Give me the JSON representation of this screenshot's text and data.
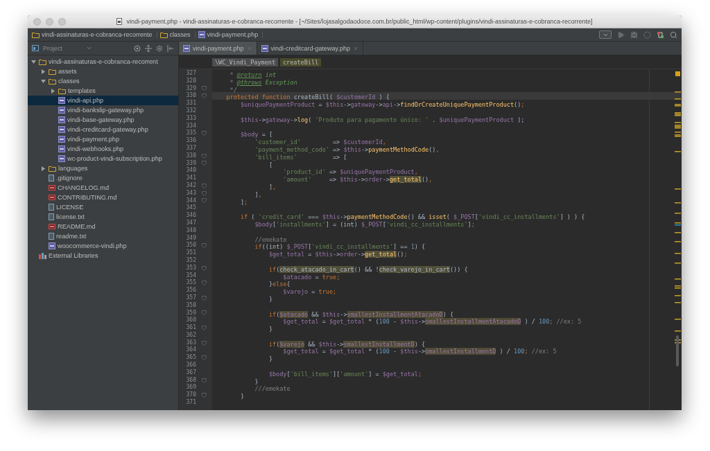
{
  "window": {
    "title": "vindi-payment.php - vindi-assinaturas-e-cobranca-recorrente - [~/Sites/lojasalgodaodoce.com.br/public_html/wp-content/plugins/vindi-assinaturas-e-cobranca-recorrente]"
  },
  "navbar": {
    "crumbs": [
      {
        "label": "vindi-assinaturas-e-cobranca-recorrente",
        "kind": "folder"
      },
      {
        "label": "classes",
        "kind": "folder"
      },
      {
        "label": "vindi-payment.php",
        "kind": "php"
      }
    ]
  },
  "project_panel": {
    "title": "Project",
    "tree": [
      {
        "name": "vindi-assinaturas-e-cobranca-recorrent",
        "kind": "folder",
        "expanded": true,
        "selected": false,
        "children": [
          {
            "name": "assets",
            "kind": "folder",
            "expanded": false,
            "selected": false
          },
          {
            "name": "classes",
            "kind": "folder",
            "expanded": true,
            "selected": false,
            "children": [
              {
                "name": "templates",
                "kind": "folder",
                "expanded": false,
                "selected": false
              },
              {
                "name": "vindi-api.php",
                "kind": "php",
                "selected": true
              },
              {
                "name": "vindi-bankslip-gateway.php",
                "kind": "php",
                "selected": false
              },
              {
                "name": "vindi-base-gateway.php",
                "kind": "php",
                "selected": false
              },
              {
                "name": "vindi-creditcard-gateway.php",
                "kind": "php",
                "selected": false
              },
              {
                "name": "vindi-payment.php",
                "kind": "php",
                "selected": false
              },
              {
                "name": "vindi-webhooks.php",
                "kind": "php",
                "selected": false
              },
              {
                "name": "wc-product-vindi-subscription.php",
                "kind": "php",
                "selected": false
              }
            ]
          },
          {
            "name": "languages",
            "kind": "folder",
            "expanded": false,
            "selected": false
          },
          {
            "name": ".gitignore",
            "kind": "text",
            "selected": false
          },
          {
            "name": "CHANGELOG.md",
            "kind": "md",
            "selected": false
          },
          {
            "name": "CONTRIBUTING.md",
            "kind": "md",
            "selected": false
          },
          {
            "name": "LICENSE",
            "kind": "text",
            "selected": false
          },
          {
            "name": "license.txt",
            "kind": "text",
            "selected": false
          },
          {
            "name": "README.md",
            "kind": "md",
            "selected": false
          },
          {
            "name": "readme.txt",
            "kind": "text",
            "selected": false
          },
          {
            "name": "woocommerce-vindi.php",
            "kind": "php",
            "selected": false
          }
        ]
      },
      {
        "name": "External Libraries",
        "kind": "library",
        "selected": false
      }
    ]
  },
  "tabs": [
    {
      "label": "vindi-payment.php",
      "selected": true
    },
    {
      "label": "vindi-creditcard-gateway.php",
      "selected": false
    }
  ],
  "editor": {
    "breadcrumbs": [
      {
        "label": "\\WC_Vindi_Payment",
        "kind": "class"
      },
      {
        "label": "createBill",
        "kind": "method"
      }
    ],
    "lines": [
      {
        "num": "327",
        "fold": false,
        "current": false,
        "tokens": [
          {
            "kind": "c",
            "text": "     * "
          },
          {
            "kind": "dt",
            "text": "@return"
          },
          {
            "kind": "di",
            "text": " int"
          }
        ]
      },
      {
        "num": "328",
        "fold": false,
        "current": false,
        "tokens": [
          {
            "kind": "c",
            "text": "     * "
          },
          {
            "kind": "dt",
            "text": "@throws"
          },
          {
            "kind": "di",
            "text": " Exception"
          }
        ]
      },
      {
        "num": "329",
        "fold": true,
        "current": false,
        "tokens": [
          {
            "kind": "c",
            "text": "     */"
          }
        ]
      },
      {
        "num": "330",
        "fold": true,
        "current": true,
        "tokens": [
          {
            "kind": "k",
            "text": "    protected function "
          },
          {
            "kind": "p",
            "text": "createBill( "
          },
          {
            "kind": "v",
            "text": "$customerId"
          },
          {
            "kind": "p",
            "text": " ) {"
          }
        ]
      },
      {
        "num": "331",
        "fold": false,
        "current": false,
        "tokens": [
          {
            "kind": "v",
            "text": "        $uniquePaymentProduct"
          },
          {
            "kind": "p",
            "text": " = "
          },
          {
            "kind": "v",
            "text": "$this"
          },
          {
            "kind": "p",
            "text": "->"
          },
          {
            "kind": "v",
            "text": "gateway"
          },
          {
            "kind": "p",
            "text": "->"
          },
          {
            "kind": "v",
            "text": "api"
          },
          {
            "kind": "p",
            "text": "->"
          },
          {
            "kind": "f",
            "text": "findOrCreateUniquePaymentProduct"
          },
          {
            "kind": "p",
            "text": "()"
          },
          {
            "kind": "k",
            "text": ";"
          }
        ]
      },
      {
        "num": "332",
        "fold": false,
        "current": false
      },
      {
        "num": "333",
        "fold": false,
        "current": false,
        "tokens": [
          {
            "kind": "v",
            "text": "        $this"
          },
          {
            "kind": "p",
            "text": "->"
          },
          {
            "kind": "v",
            "text": "gateway"
          },
          {
            "kind": "p",
            "text": "->"
          },
          {
            "kind": "f",
            "text": "log"
          },
          {
            "kind": "p",
            "text": "( "
          },
          {
            "kind": "s",
            "text": "'Produto para pagamento único: '"
          },
          {
            "kind": "p",
            "text": " . "
          },
          {
            "kind": "v",
            "text": "$uniquePaymentProduct"
          },
          {
            "kind": "p",
            "text": " );"
          }
        ]
      },
      {
        "num": "334",
        "fold": false,
        "current": false
      },
      {
        "num": "335",
        "fold": true,
        "current": false,
        "tokens": [
          {
            "kind": "v",
            "text": "        $body"
          },
          {
            "kind": "p",
            "text": " = ["
          }
        ]
      },
      {
        "num": "336",
        "fold": false,
        "current": false,
        "tokens": [
          {
            "kind": "s",
            "text": "            'customer_id'"
          },
          {
            "kind": "p",
            "text": "         => "
          },
          {
            "kind": "v",
            "text": "$customerId"
          },
          {
            "kind": "k",
            "text": ","
          }
        ]
      },
      {
        "num": "337",
        "fold": false,
        "current": false,
        "tokens": [
          {
            "kind": "s",
            "text": "            'payment_method_code'"
          },
          {
            "kind": "p",
            "text": " => "
          },
          {
            "kind": "v",
            "text": "$this"
          },
          {
            "kind": "p",
            "text": "->"
          },
          {
            "kind": "f",
            "text": "paymentMethodCode"
          },
          {
            "kind": "p",
            "text": "()"
          },
          {
            "kind": "k",
            "text": ","
          }
        ]
      },
      {
        "num": "338",
        "fold": true,
        "current": false,
        "tokens": [
          {
            "kind": "s",
            "text": "            'bill_items'"
          },
          {
            "kind": "p",
            "text": "          => ["
          }
        ]
      },
      {
        "num": "339",
        "fold": true,
        "current": false,
        "tokens": [
          {
            "kind": "p",
            "text": "                ["
          }
        ]
      },
      {
        "num": "340",
        "fold": false,
        "current": false,
        "tokens": [
          {
            "kind": "s",
            "text": "                    'product_id'"
          },
          {
            "kind": "p",
            "text": " => "
          },
          {
            "kind": "v",
            "text": "$uniquePaymentProduct"
          },
          {
            "kind": "k",
            "text": ","
          }
        ]
      },
      {
        "num": "341",
        "fold": false,
        "current": false,
        "tokens": [
          {
            "kind": "s",
            "text": "                    'amount'"
          },
          {
            "kind": "p",
            "text": "     => "
          },
          {
            "kind": "v",
            "text": "$this"
          },
          {
            "kind": "p",
            "text": "->"
          },
          {
            "kind": "v",
            "text": "order"
          },
          {
            "kind": "p",
            "text": "->"
          },
          {
            "kind": "fh",
            "text": "get_total"
          },
          {
            "kind": "p",
            "text": "()"
          },
          {
            "kind": "k",
            "text": ","
          }
        ]
      },
      {
        "num": "342",
        "fold": true,
        "current": false,
        "tokens": [
          {
            "kind": "p",
            "text": "                ]"
          },
          {
            "kind": "k",
            "text": ","
          }
        ]
      },
      {
        "num": "343",
        "fold": true,
        "current": false,
        "tokens": [
          {
            "kind": "p",
            "text": "            ]"
          },
          {
            "kind": "k",
            "text": ","
          }
        ]
      },
      {
        "num": "344",
        "fold": true,
        "current": false,
        "tokens": [
          {
            "kind": "p",
            "text": "        ]"
          },
          {
            "kind": "k",
            "text": ";"
          }
        ]
      },
      {
        "num": "345",
        "fold": false,
        "current": false
      },
      {
        "num": "346",
        "fold": false,
        "current": false,
        "tokens": [
          {
            "kind": "k",
            "text": "        if"
          },
          {
            "kind": "p",
            "text": " ( "
          },
          {
            "kind": "s",
            "text": "'credit_card'"
          },
          {
            "kind": "p",
            "text": " === "
          },
          {
            "kind": "v",
            "text": "$this"
          },
          {
            "kind": "p",
            "text": "->"
          },
          {
            "kind": "f",
            "text": "paymentMethodCode"
          },
          {
            "kind": "p",
            "text": "() && "
          },
          {
            "kind": "f",
            "text": "isset"
          },
          {
            "kind": "p",
            "text": "( "
          },
          {
            "kind": "v",
            "text": "$_POST"
          },
          {
            "kind": "p",
            "text": "["
          },
          {
            "kind": "s",
            "text": "'vindi_cc_installments'"
          },
          {
            "kind": "p",
            "text": "] ) ) {"
          }
        ]
      },
      {
        "num": "347",
        "fold": false,
        "current": false,
        "tokens": [
          {
            "kind": "v",
            "text": "            $body"
          },
          {
            "kind": "p",
            "text": "["
          },
          {
            "kind": "s",
            "text": "'installments'"
          },
          {
            "kind": "p",
            "text": "] = (int) "
          },
          {
            "kind": "v",
            "text": "$_POST"
          },
          {
            "kind": "p",
            "text": "["
          },
          {
            "kind": "s",
            "text": "'vindi_cc_installments'"
          },
          {
            "kind": "p",
            "text": "]"
          },
          {
            "kind": "k",
            "text": ";"
          }
        ]
      },
      {
        "num": "348",
        "fold": false,
        "current": false
      },
      {
        "num": "349",
        "fold": false,
        "current": false,
        "tokens": [
          {
            "kind": "c",
            "text": "            //emekate"
          }
        ]
      },
      {
        "num": "350",
        "fold": true,
        "current": false,
        "tokens": [
          {
            "kind": "k",
            "text": "            if"
          },
          {
            "kind": "p",
            "text": "((int) "
          },
          {
            "kind": "v",
            "text": "$_POST"
          },
          {
            "kind": "p",
            "text": "["
          },
          {
            "kind": "s",
            "text": "'vindi_cc_installments'"
          },
          {
            "kind": "p",
            "text": "] == "
          },
          {
            "kind": "n",
            "text": "1"
          },
          {
            "kind": "p",
            "text": ") {"
          }
        ]
      },
      {
        "num": "351",
        "fold": false,
        "current": false,
        "tokens": [
          {
            "kind": "v",
            "text": "                $get_total"
          },
          {
            "kind": "p",
            "text": " = "
          },
          {
            "kind": "v",
            "text": "$this"
          },
          {
            "kind": "p",
            "text": "->"
          },
          {
            "kind": "v",
            "text": "order"
          },
          {
            "kind": "p",
            "text": "->"
          },
          {
            "kind": "fh",
            "text": "get_total"
          },
          {
            "kind": "p",
            "text": "()"
          },
          {
            "kind": "k",
            "text": ";"
          }
        ]
      },
      {
        "num": "352",
        "fold": false,
        "current": false
      },
      {
        "num": "353",
        "fold": true,
        "current": false,
        "tokens": [
          {
            "kind": "k",
            "text": "                if"
          },
          {
            "kind": "p",
            "text": "("
          },
          {
            "kind": "ph",
            "text": "check_atacado_in_cart"
          },
          {
            "kind": "p",
            "text": "() && !"
          },
          {
            "kind": "ph",
            "text": "check_varejo_in_cart"
          },
          {
            "kind": "p",
            "text": "()) {"
          }
        ]
      },
      {
        "num": "354",
        "fold": false,
        "current": false,
        "tokens": [
          {
            "kind": "v",
            "text": "                    $atacado"
          },
          {
            "kind": "p",
            "text": " = "
          },
          {
            "kind": "k",
            "text": "true;"
          }
        ]
      },
      {
        "num": "355",
        "fold": true,
        "current": false,
        "tokens": [
          {
            "kind": "p",
            "text": "                }"
          },
          {
            "kind": "k",
            "text": "else"
          },
          {
            "kind": "p",
            "text": "{"
          }
        ]
      },
      {
        "num": "356",
        "fold": false,
        "current": false,
        "tokens": [
          {
            "kind": "v",
            "text": "                    $varejo"
          },
          {
            "kind": "p",
            "text": " = "
          },
          {
            "kind": "k",
            "text": "true;"
          }
        ]
      },
      {
        "num": "357",
        "fold": true,
        "current": false,
        "tokens": [
          {
            "kind": "p",
            "text": "                }"
          }
        ]
      },
      {
        "num": "358",
        "fold": false,
        "current": false
      },
      {
        "num": "359",
        "fold": true,
        "current": false,
        "tokens": [
          {
            "kind": "k",
            "text": "                if"
          },
          {
            "kind": "p",
            "text": "("
          },
          {
            "kind": "vh",
            "text": "$atacado"
          },
          {
            "kind": "p",
            "text": " && "
          },
          {
            "kind": "v",
            "text": "$this"
          },
          {
            "kind": "p",
            "text": "->"
          },
          {
            "kind": "vh",
            "text": "smallestInstallmentAtacadoD"
          },
          {
            "kind": "p",
            "text": ") {"
          }
        ]
      },
      {
        "num": "360",
        "fold": false,
        "current": false,
        "tokens": [
          {
            "kind": "v",
            "text": "                    $get_total"
          },
          {
            "kind": "p",
            "text": " = "
          },
          {
            "kind": "v",
            "text": "$get_total"
          },
          {
            "kind": "p",
            "text": " * ("
          },
          {
            "kind": "n",
            "text": "100"
          },
          {
            "kind": "p",
            "text": " - "
          },
          {
            "kind": "v",
            "text": "$this"
          },
          {
            "kind": "p",
            "text": "->"
          },
          {
            "kind": "vh",
            "text": "smallestInstallmentAtacadoD"
          },
          {
            "kind": "p",
            "text": " ) / "
          },
          {
            "kind": "n",
            "text": "100"
          },
          {
            "kind": "k",
            "text": ";"
          },
          {
            "kind": "c",
            "text": " //ex: 5"
          }
        ]
      },
      {
        "num": "361",
        "fold": true,
        "current": false,
        "tokens": [
          {
            "kind": "p",
            "text": "                }"
          }
        ]
      },
      {
        "num": "362",
        "fold": false,
        "current": false
      },
      {
        "num": "363",
        "fold": true,
        "current": false,
        "tokens": [
          {
            "kind": "k",
            "text": "                if"
          },
          {
            "kind": "p",
            "text": "("
          },
          {
            "kind": "vh",
            "text": "$varejo"
          },
          {
            "kind": "p",
            "text": " && "
          },
          {
            "kind": "v",
            "text": "$this"
          },
          {
            "kind": "p",
            "text": "->"
          },
          {
            "kind": "vh",
            "text": "smallestInstallmentD"
          },
          {
            "kind": "p",
            "text": ") {"
          }
        ]
      },
      {
        "num": "364",
        "fold": false,
        "current": false,
        "tokens": [
          {
            "kind": "v",
            "text": "                    $get_total"
          },
          {
            "kind": "p",
            "text": " = "
          },
          {
            "kind": "v",
            "text": "$get_total"
          },
          {
            "kind": "p",
            "text": " * ("
          },
          {
            "kind": "n",
            "text": "100"
          },
          {
            "kind": "p",
            "text": " - "
          },
          {
            "kind": "v",
            "text": "$this"
          },
          {
            "kind": "p",
            "text": "->"
          },
          {
            "kind": "vh",
            "text": "smallestInstallmentD"
          },
          {
            "kind": "p",
            "text": " ) / "
          },
          {
            "kind": "n",
            "text": "100"
          },
          {
            "kind": "k",
            "text": ";"
          },
          {
            "kind": "c",
            "text": " //ex: 5"
          }
        ]
      },
      {
        "num": "365",
        "fold": true,
        "current": false,
        "tokens": [
          {
            "kind": "p",
            "text": "                }"
          }
        ]
      },
      {
        "num": "366",
        "fold": false,
        "current": false
      },
      {
        "num": "367",
        "fold": false,
        "current": false,
        "tokens": [
          {
            "kind": "v",
            "text": "                $body"
          },
          {
            "kind": "p",
            "text": "["
          },
          {
            "kind": "s",
            "text": "'bill_items'"
          },
          {
            "kind": "p",
            "text": "]["
          },
          {
            "kind": "s",
            "text": "'amount'"
          },
          {
            "kind": "p",
            "text": "] = "
          },
          {
            "kind": "v",
            "text": "$get_total"
          },
          {
            "kind": "k",
            "text": ";"
          }
        ]
      },
      {
        "num": "368",
        "fold": true,
        "current": false,
        "tokens": [
          {
            "kind": "p",
            "text": "            }"
          }
        ]
      },
      {
        "num": "369",
        "fold": false,
        "current": false,
        "tokens": [
          {
            "kind": "c",
            "text": "            ///emekate"
          }
        ]
      },
      {
        "num": "370",
        "fold": true,
        "current": false,
        "tokens": [
          {
            "kind": "p",
            "text": "        }"
          }
        ]
      },
      {
        "num": "371",
        "fold": false,
        "current": false
      }
    ]
  }
}
